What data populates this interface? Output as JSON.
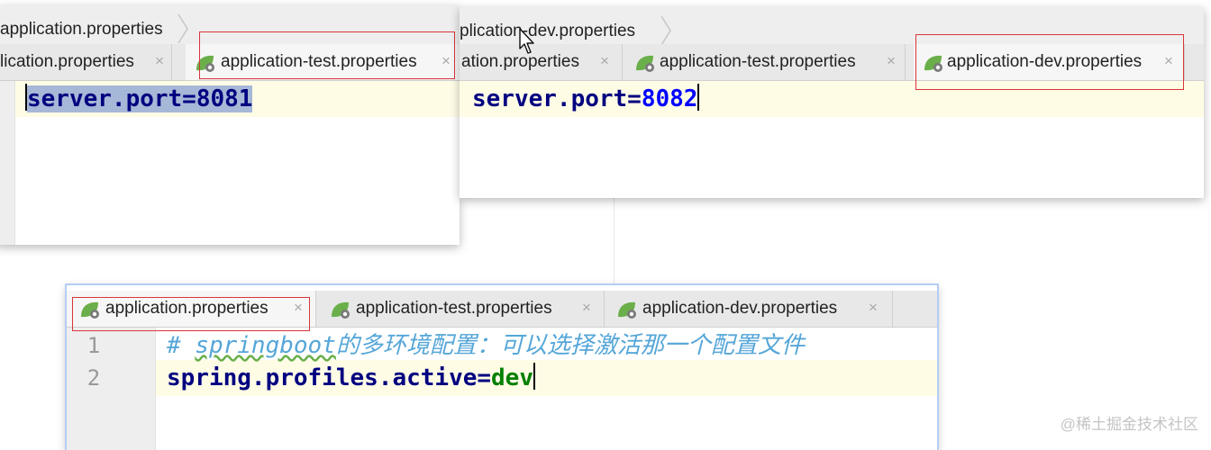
{
  "win_test": {
    "breadcrumb": "application.properties",
    "tabs": [
      {
        "label": "lication.properties",
        "close": "×"
      },
      {
        "label": "application-test.properties",
        "close": "×"
      }
    ],
    "code": {
      "key": "server.port=",
      "value": "8081"
    }
  },
  "win_dev": {
    "breadcrumb": "plication-dev.properties",
    "tabs": [
      {
        "label": "ation.properties",
        "close": "×"
      },
      {
        "label": "application-test.properties",
        "close": "×"
      },
      {
        "label": "application-dev.properties",
        "close": "×"
      }
    ],
    "code": {
      "key": "server.port=",
      "value": "8082"
    }
  },
  "win_main": {
    "tabs": [
      {
        "label": "application.properties",
        "close": "×"
      },
      {
        "label": "application-test.properties",
        "close": "×"
      },
      {
        "label": "application-dev.properties",
        "close": "×"
      }
    ],
    "lines": [
      {
        "num": "1",
        "comment_mark": "# ",
        "comment_word": "springboot",
        "comment_rest": "的多环境配置：可以选择激活那一个配置文件"
      },
      {
        "num": "2",
        "key": "spring.profiles.active=",
        "value": "dev"
      }
    ]
  },
  "icons": {
    "tab": "spring-leaf-icon",
    "cursor": "mouse-pointer-icon"
  },
  "colors": {
    "highlight_box": "#d9353a",
    "selection": "#a6b8d7",
    "current_line": "#fffce6"
  },
  "watermark": "@稀土掘金技术社区"
}
